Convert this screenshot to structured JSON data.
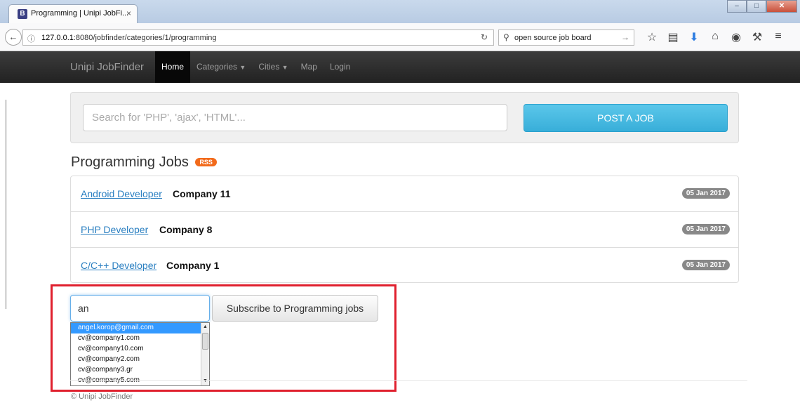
{
  "browser": {
    "tab_title": "Programming | Unipi JobFi...",
    "tab_favicon": "B",
    "tab_close": "×",
    "url_host": "127.0.0.1",
    "url_path": ":8080/jobfinder/categories/1/programming",
    "search_text": "open source job board",
    "icons": [
      "back-arrow-icon",
      "info-icon",
      "reload-icon",
      "search-icon",
      "forward-arrow-icon",
      "star-icon",
      "reading-list-icon",
      "download-icon",
      "home-icon",
      "adblock-icon",
      "tools-icon",
      "menu-icon"
    ]
  },
  "nav": {
    "brand": "Unipi JobFinder",
    "items": [
      "Home",
      "Categories",
      "Cities",
      "Map",
      "Login"
    ]
  },
  "search": {
    "placeholder": "Search for 'PHP', 'ajax', 'HTML'...",
    "post_button": "POST A JOB"
  },
  "heading": {
    "title": "Programming Jobs",
    "rss": "RSS"
  },
  "jobs": [
    {
      "title": "Android Developer",
      "company": "Company 11",
      "date": "05 Jan 2017"
    },
    {
      "title": "PHP Developer",
      "company": "Company 8",
      "date": "05 Jan 2017"
    },
    {
      "title": "C/C++ Developer",
      "company": "Company 1",
      "date": "05 Jan 2017"
    }
  ],
  "subscribe": {
    "input_value": "an",
    "button": "Subscribe to Programming jobs",
    "suggestions": [
      "angel.korop@gmail.com",
      "cv@company1.com",
      "cv@company10.com",
      "cv@company2.com",
      "cv@company3.gr",
      "cv@company5.com"
    ]
  },
  "footer": "© Unipi JobFinder",
  "colors": {
    "accent": "#5bc7ea",
    "highlight": "#e0202e",
    "link": "#2a7fc1",
    "rss": "#f26a1b"
  }
}
